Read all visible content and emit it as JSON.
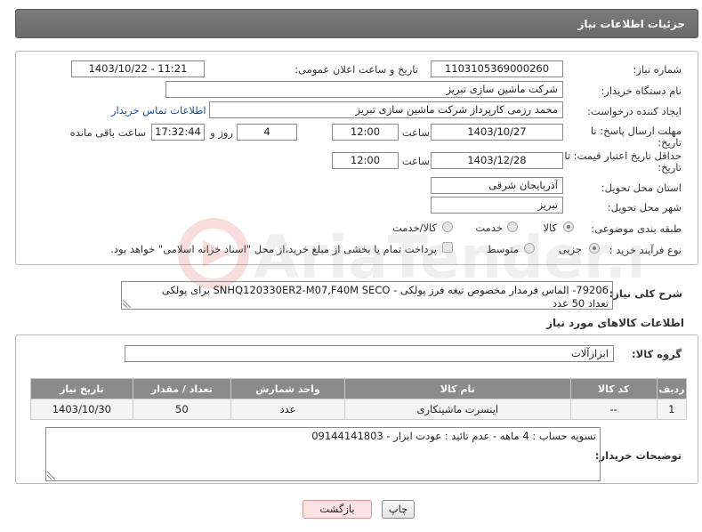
{
  "panel_title": "جزئیات اطلاعات نیاز",
  "fields": {
    "need_number_label": "شماره نیاز:",
    "need_number": "1103105369000260",
    "announce_label": "تاریخ و ساعت اعلان عمومی:",
    "announce_value": "1403/10/22 - 11:21",
    "buyer_org_label": "نام دستگاه خریدار:",
    "buyer_org": "شرکت ماشین سازی تبریز",
    "requester_label": "ایجاد کننده درخواست:",
    "requester": "محمد رزمی کارپرداز شرکت ماشین سازی تبریز",
    "contact_link": "اطلاعات تماس خریدار",
    "reply_deadline_label_1": "مهلت ارسال پاسخ: تا",
    "reply_deadline_label_2": "تاریخ:",
    "reply_date": "1403/10/27",
    "time_label": "ساعت",
    "reply_time": "12:00",
    "days_value": "4",
    "days_label": "روز و",
    "remaining_time": "17:32:44",
    "remaining_label": "ساعت باقی مانده",
    "validity_label_1": "حداقل تاریخ اعتبار قیمت: تا",
    "validity_label_2": "تاریخ:",
    "validity_date": "1403/12/28",
    "validity_time_label": "ساعت",
    "validity_time": "12:00",
    "province_label": "استان محل تحویل:",
    "province": "آذربایجان شرقی",
    "city_label": "شهر محل تحویل:",
    "city": "تبریز",
    "category_label": "طبقه بندی موضوعی:",
    "category_options": [
      "کالا",
      "خدمت",
      "کالا/خدمت"
    ],
    "process_label": "نوع فرآیند خرید :",
    "process_options": [
      "جزیی",
      "متوسط"
    ],
    "payment_note": "پرداخت تمام یا بخشی از مبلغ خرید،از محل \"اسناد خزانه اسلامی\" خواهد بود."
  },
  "description": {
    "label": "شرح کلی نیاز:",
    "line1": "79206- الماس فرمدار مخصوص تیغه فرز پولکی - SNHQ120330ER2-M07,F40M  SECO برای پولکی",
    "line2": "تعداد 50 عدد"
  },
  "goods_section_title": "اطلاعات کالاهای مورد نیاز",
  "goods_group_label": "گروه کالا:",
  "goods_group": "ابزارآلات",
  "table": {
    "headers": [
      "ردیف",
      "کد کالا",
      "نام کالا",
      "واحد شمارش",
      "تعداد / مقدار",
      "تاریخ نیاز"
    ],
    "rows": [
      [
        "1",
        "--",
        "اینسرت ماشینکاری",
        "عدد",
        "50",
        "1403/10/30"
      ]
    ]
  },
  "buyer_notes_label": "توضیحات خریدار:",
  "buyer_notes": "تسویه حساب : 4 ماهه - عدم تائید : عودت ابزار - 09144141803",
  "buttons": {
    "print": "چاپ",
    "back": "بازگشت"
  },
  "watermark": "AriaTender.neT"
}
